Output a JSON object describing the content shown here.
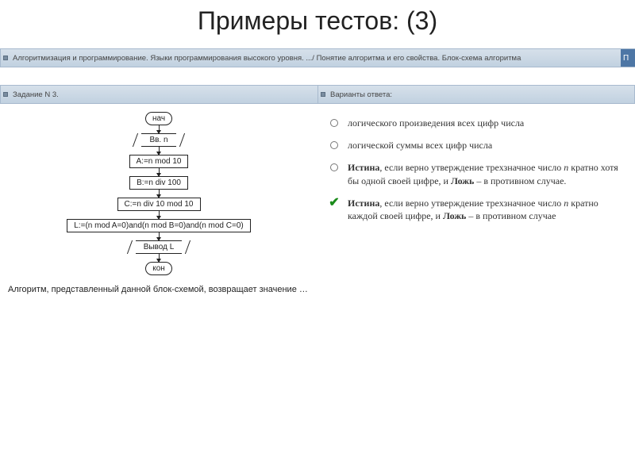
{
  "title": "Примеры тестов: (3)",
  "breadcrumb": "Алгоритмизация и программирование. Языки программирования высокого уровня. .../ Понятие алгоритма и его свойства. Блок-схема алгоритма",
  "tab_tail": "П",
  "sub_left": "Задание N 3.",
  "sub_right": "Варианты ответа:",
  "flow": {
    "start": "нач",
    "input": "Вв. n",
    "s1": "A:=n mod 10",
    "s2": "B:=n div 100",
    "s3": "C:=n div 10 mod 10",
    "s4": "L:=(n mod A=0)and(n mod B=0)and(n mod C=0)",
    "output": "Вывод L",
    "end": "кон"
  },
  "prompt": "Алгоритм, представленный данной блок-схемой, возвращает значение …",
  "answers": [
    {
      "selected": false,
      "text": "логического произведения всех цифр числа"
    },
    {
      "selected": false,
      "text": "логической суммы всех цифр числа"
    },
    {
      "selected": false,
      "html": "<b>Истина</b>, если верно утверждение трехзначное число <i class='var'>n</i> кратно хотя бы одной своей цифре, и <b>Ложь</b> – в противном случае."
    },
    {
      "selected": true,
      "html": "<b>Истина</b>, если верно утверждение трехзначное число <i class='var'>n</i> кратно каждой своей цифре, и <b>Ложь</b> – в противном случае"
    }
  ]
}
